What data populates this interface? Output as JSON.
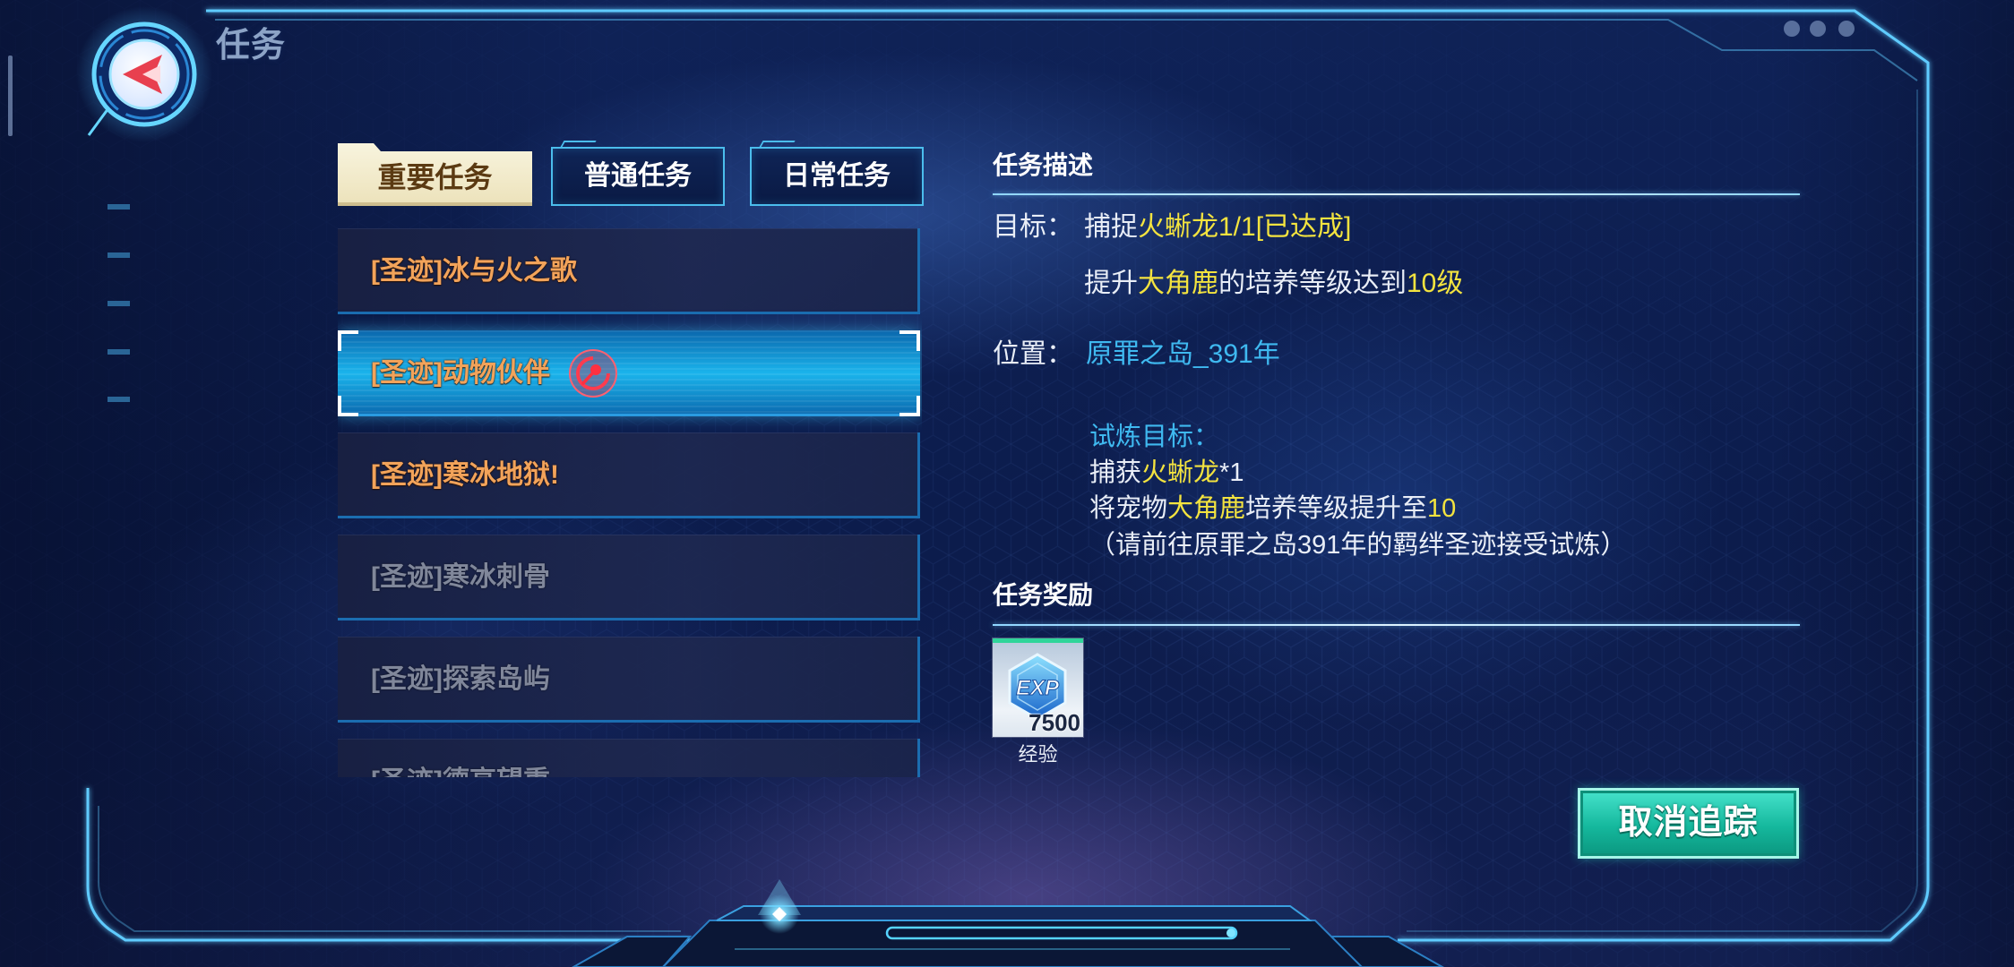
{
  "header": {
    "title": "任务",
    "back_icon": "back-arrow-icon"
  },
  "tabs": [
    {
      "label": "重要任务",
      "selected": true
    },
    {
      "label": "普通任务",
      "selected": false
    },
    {
      "label": "日常任务",
      "selected": false
    }
  ],
  "quests": [
    {
      "name": "[圣迹]冰与火之歌",
      "selected": false,
      "dimmed": false,
      "tracked": false
    },
    {
      "name": "[圣迹]动物伙伴",
      "selected": true,
      "dimmed": false,
      "tracked": true
    },
    {
      "name": "[圣迹]寒冰地狱!",
      "selected": false,
      "dimmed": false,
      "tracked": false
    },
    {
      "name": "[圣迹]寒冰刺骨",
      "selected": false,
      "dimmed": true,
      "tracked": false
    },
    {
      "name": "[圣迹]探索岛屿",
      "selected": false,
      "dimmed": true,
      "tracked": false
    },
    {
      "name": "[圣迹]德高望重",
      "selected": false,
      "dimmed": true,
      "tracked": false
    }
  ],
  "track_icon": "track-icon",
  "detail": {
    "description_title": "任务描述",
    "goal_label": "目标：",
    "goals": [
      [
        {
          "text": "捕捉"
        },
        {
          "text": "火蜥龙1/1[已达成]",
          "hl": true
        }
      ],
      [
        {
          "text": "提升"
        },
        {
          "text": "大角鹿",
          "hl": true
        },
        {
          "text": "的培养等级达到"
        },
        {
          "text": "10级",
          "hl": true
        }
      ]
    ],
    "location_label": "位置：",
    "location": "原罪之岛_391年",
    "trial": {
      "title": "试炼目标：",
      "lines": [
        [
          {
            "text": "捕获"
          },
          {
            "text": "火蜥龙",
            "hl": true
          },
          {
            "text": "*1"
          }
        ],
        [
          {
            "text": "将宠物"
          },
          {
            "text": "大角鹿",
            "hl": true
          },
          {
            "text": "培养等级提升至"
          },
          {
            "text": "10",
            "hl": true
          }
        ],
        [
          {
            "text": "（请前往原罪之岛391年的羁绊圣迹接受试炼）"
          }
        ]
      ]
    },
    "reward_title": "任务奖励",
    "rewards": [
      {
        "icon": "exp-icon",
        "icon_text": "EXP",
        "amount": "7500",
        "label": "经验"
      }
    ]
  },
  "actions": {
    "cancel_tracking": "取消追踪"
  },
  "colors": {
    "quest_active": "#f2a35a",
    "quest_dimmed": "#80879a",
    "highlight": "#f3e33f",
    "location": "#3fb9f0",
    "trial_title": "#3fb9f0",
    "tab_selected_bg": "#ece2ba",
    "tab_selected_text": "#5b3a12",
    "tab_border": "#4bbdec",
    "button": "#15b89d",
    "reward_strip": "#2fd59a",
    "frame": "#5fcbff"
  }
}
